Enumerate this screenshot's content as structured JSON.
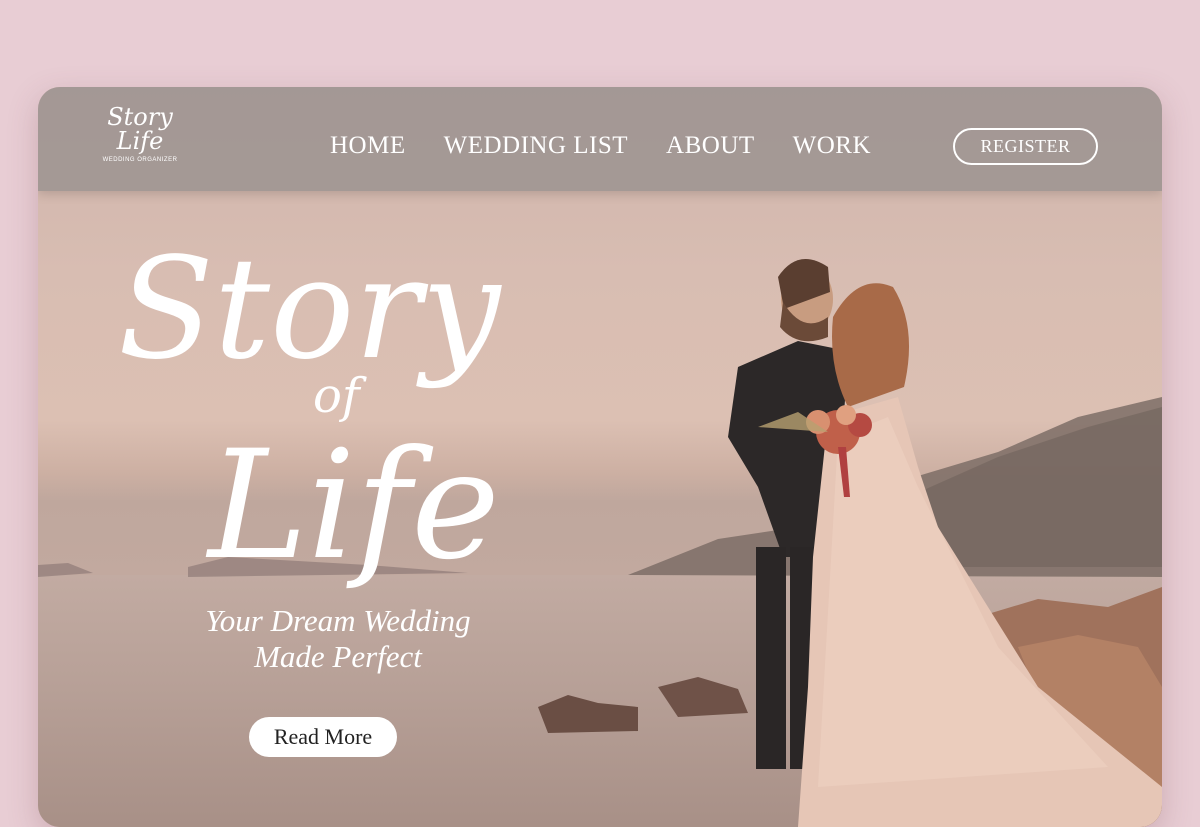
{
  "logo": {
    "line1": "Story",
    "line2": "Life",
    "subtitle": "WEDDING ORGANIZER"
  },
  "nav": {
    "items": [
      {
        "label": "HOME"
      },
      {
        "label": "WEDDING LIST"
      },
      {
        "label": "ABOUT"
      },
      {
        "label": "WORK"
      }
    ],
    "register_label": "REGISTER"
  },
  "hero": {
    "title_line1": "Story",
    "title_of": "of",
    "title_line2": "Life",
    "tagline_line1": "Your Dream Wedding",
    "tagline_line2": "Made Perfect",
    "cta_label": "Read More"
  },
  "colors": {
    "background": "#e8cdd4",
    "navbar": "#a0968f",
    "text": "#ffffff"
  }
}
